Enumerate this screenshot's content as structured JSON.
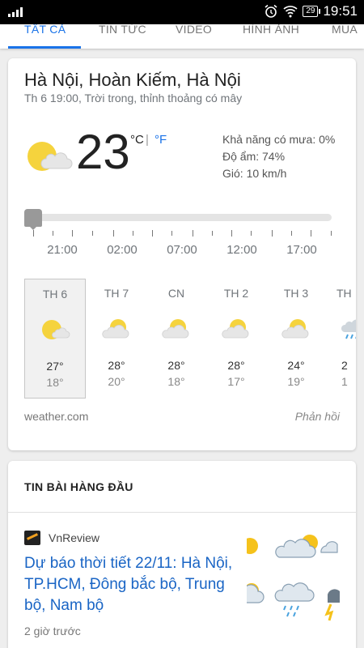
{
  "status_bar": {
    "battery": "29",
    "time": "19:51"
  },
  "tabs": [
    "TẤT CẢ",
    "TIN TỨC",
    "VIDEO",
    "HÌNH ẢNH",
    "MUA"
  ],
  "weather": {
    "location": "Hà Nội, Hoàn Kiếm, Hà Nội",
    "subtitle": "Th 6 19:00, Trời trong, thỉnh thoảng có mây",
    "temperature": "23",
    "unit_c": "°C",
    "unit_sep": "|",
    "unit_f": "°F",
    "rain": "Khả năng có mưa: 0%",
    "humidity": "Độ ẩm: 74%",
    "wind": "Gió: 10 km/h",
    "hours": [
      "21:00",
      "02:00",
      "07:00",
      "12:00",
      "17:00"
    ],
    "days": [
      {
        "name": "TH 6",
        "high": "27°",
        "low": "18°",
        "icon": "sun-cloud-icon"
      },
      {
        "name": "TH 7",
        "high": "28°",
        "low": "20°",
        "icon": "partly-cloudy-icon"
      },
      {
        "name": "CN",
        "high": "28°",
        "low": "18°",
        "icon": "partly-cloudy-icon"
      },
      {
        "name": "TH 2",
        "high": "28°",
        "low": "17°",
        "icon": "partly-cloudy-icon"
      },
      {
        "name": "TH 3",
        "high": "24°",
        "low": "19°",
        "icon": "partly-cloudy-icon"
      },
      {
        "name": "TH",
        "high": "2",
        "low": "1",
        "icon": "rain-icon"
      }
    ],
    "source": "weather.com",
    "feedback": "Phản hồi"
  },
  "news": {
    "heading": "TIN BÀI HÀNG ĐẦU",
    "publisher": "VnReview",
    "title": "Dự báo thời tiết 22/11: Hà Nội, TP.HCM, Đông bắc bộ, Trung bộ, Nam bộ",
    "time": "2 giờ trước"
  },
  "colors": {
    "accent": "#1a73e8",
    "link": "#1a65c5",
    "sun": "#f5d33d"
  }
}
